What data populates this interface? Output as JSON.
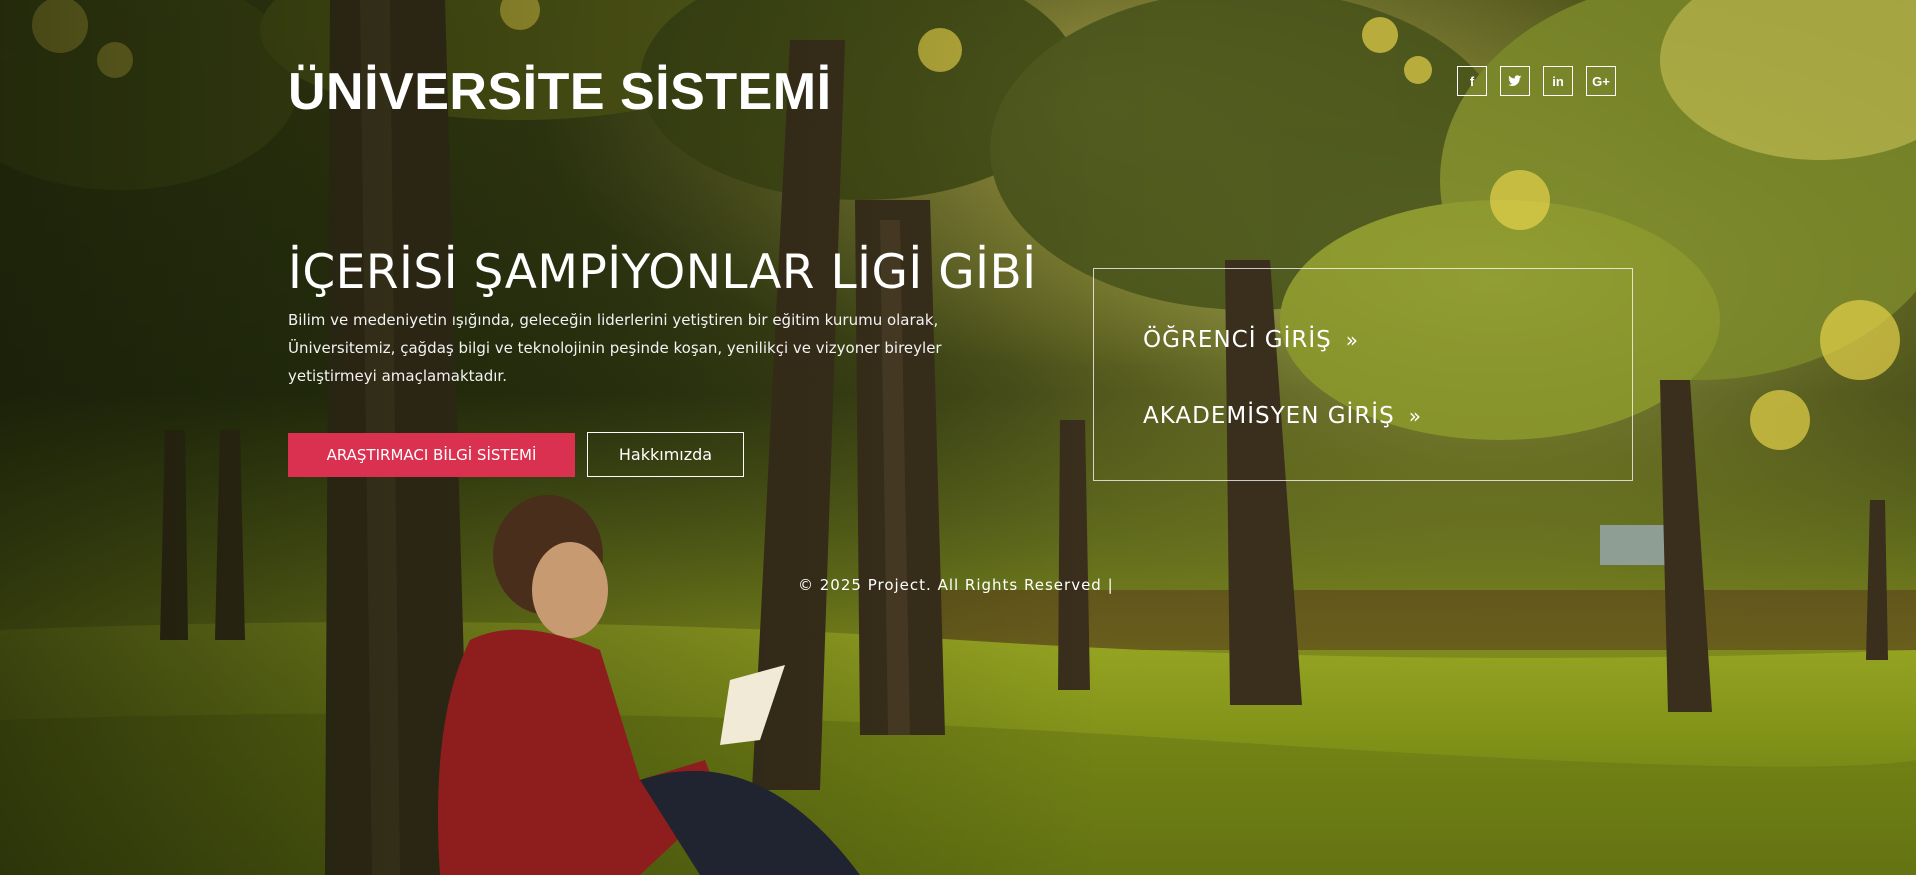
{
  "dev_label": "dev",
  "brand": {
    "title": "ÜNİVERSİTE SİSTEMİ"
  },
  "social": [
    {
      "name": "facebook-icon",
      "glyph": "f"
    },
    {
      "name": "twitter-icon",
      "glyph": "🐦"
    },
    {
      "name": "linkedin-icon",
      "glyph": "in"
    },
    {
      "name": "google-plus-icon",
      "glyph": "G+"
    }
  ],
  "hero": {
    "headline": "İÇERİSİ ŞAMPİYONLAR LİGİ GİBİ",
    "description_lines": [
      "Bilim ve medeniyetin ışığında, geleceğin liderlerini yetiştiren bir eğitim kurumu olarak,",
      "Üniversitemiz, çağdaş bilgi ve teknolojinin peşinde koşan, yenilikçi ve vizyoner bireyler",
      "yetiştirmeyi amaçlamaktadır."
    ],
    "primary_button": "ARAŞTIRMACI BİLGİ SİSTEMİ",
    "secondary_button": "Hakkımızda"
  },
  "login": {
    "student": "ÖĞRENCİ  GİRİŞ",
    "academic": "AKADEMİSYEN  GİRİŞ",
    "chevron": "»"
  },
  "footer": {
    "text": "© 2025 Project. All Rights Reserved |"
  },
  "colors": {
    "accent": "#d9314f",
    "text": "#ffffff"
  }
}
